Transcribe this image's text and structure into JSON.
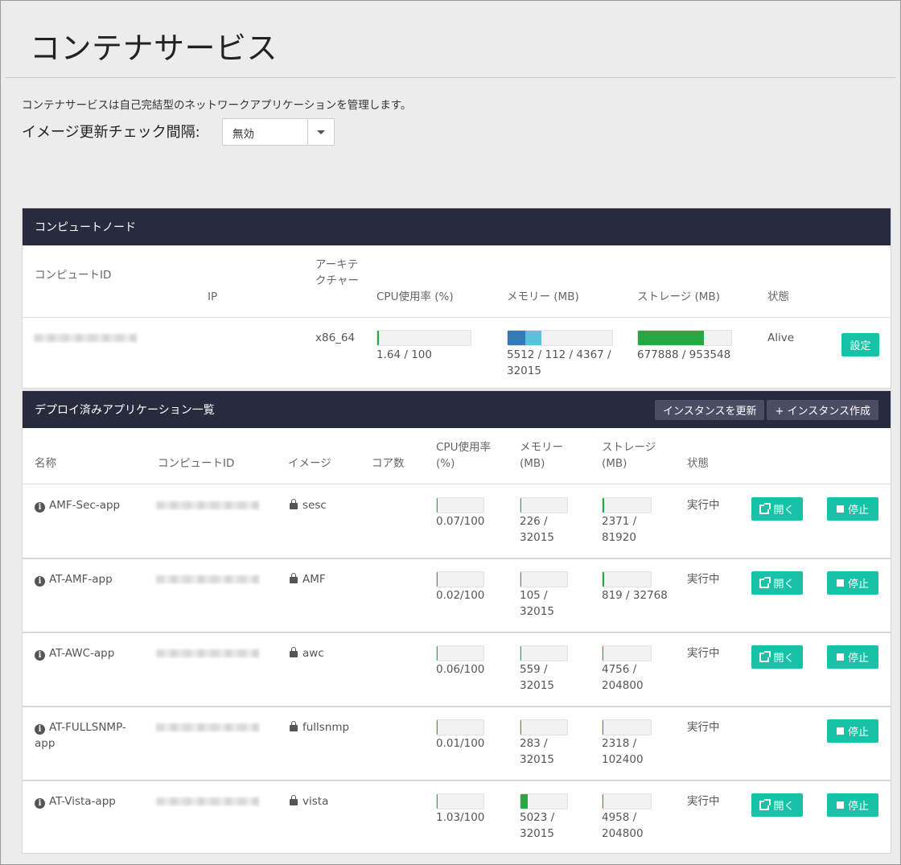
{
  "page": {
    "title": "コンテナサービス",
    "description": "コンテナサービスは自己完結型のネットワークアプリケーションを管理します。",
    "interval_label": "イメージ更新チェック間隔:",
    "interval_value": "無効"
  },
  "nodes": {
    "header": "コンピュートノード",
    "columns": {
      "compute_id": "コンピュートID",
      "ip": "IP",
      "arch": "アーキテクチャー",
      "cpu": "CPU使用率 (%)",
      "memory": "メモリー (MB)",
      "storage": "ストレージ (MB)",
      "status": "状態"
    },
    "row": {
      "arch": "x86_64",
      "cpu_text": "1.64 / 100",
      "cpu_fraction": 0.0164,
      "memory_text": "5512 / 112 / 4367 / 32015",
      "memory_segments": [
        0.172,
        0.153
      ],
      "storage_text": "677888 / 953548",
      "storage_fraction": 0.711,
      "status": "Alive",
      "settings_label": "設定"
    },
    "colors": {
      "cpu": "#28a745",
      "memory_used": "#337ab7",
      "memory_cache": "#5bc0de",
      "storage": "#28a745"
    }
  },
  "apps": {
    "header": "デプロイ済みアプリケーション一覧",
    "refresh_label": "インスタンスを更新",
    "create_label": "+ インスタンス作成",
    "columns": {
      "name": "名称",
      "compute_id": "コンピュートID",
      "image": "イメージ",
      "cores": "コア数",
      "cpu": "CPU使用率 (%)",
      "memory": "メモリー (MB)",
      "storage": "ストレージ (MB)",
      "status": "状態"
    },
    "open_label": "開く",
    "stop_label": "停止",
    "bar_color": "#28a745",
    "rows": [
      {
        "name": "AMF-Sec-app",
        "image": "sesc",
        "cpu_text": "0.07/100",
        "cpu_fraction": 0.0007,
        "memory_text": "226 / 32015",
        "memory_fraction": 0.007,
        "storage_text": "2371 / 81920",
        "storage_fraction": 0.029,
        "status": "実行中",
        "has_open": true
      },
      {
        "name": "AT-AMF-app",
        "image": "AMF",
        "cpu_text": "0.02/100",
        "cpu_fraction": 0.0002,
        "memory_text": "105 / 32015",
        "memory_fraction": 0.003,
        "storage_text": "819 / 32768",
        "storage_fraction": 0.025,
        "status": "実行中",
        "has_open": true
      },
      {
        "name": "AT-AWC-app",
        "image": "awc",
        "cpu_text": "0.06/100",
        "cpu_fraction": 0.0006,
        "memory_text": "559 / 32015",
        "memory_fraction": 0.017,
        "storage_text": "4756 / 204800",
        "storage_fraction": 0.023,
        "status": "実行中",
        "has_open": true
      },
      {
        "name": "AT-FULLSNMP-app",
        "image": "fullsnmp",
        "cpu_text": "0.01/100",
        "cpu_fraction": 0.0001,
        "memory_text": "283 / 32015",
        "memory_fraction": 0.009,
        "storage_text": "2318 / 102400",
        "storage_fraction": 0.023,
        "status": "実行中",
        "has_open": false
      },
      {
        "name": "AT-Vista-app",
        "image": "vista",
        "cpu_text": "1.03/100",
        "cpu_fraction": 0.0103,
        "memory_text": "5023 / 32015",
        "memory_fraction": 0.157,
        "storage_text": "4958 / 204800",
        "storage_fraction": 0.024,
        "status": "実行中",
        "has_open": true
      }
    ]
  }
}
